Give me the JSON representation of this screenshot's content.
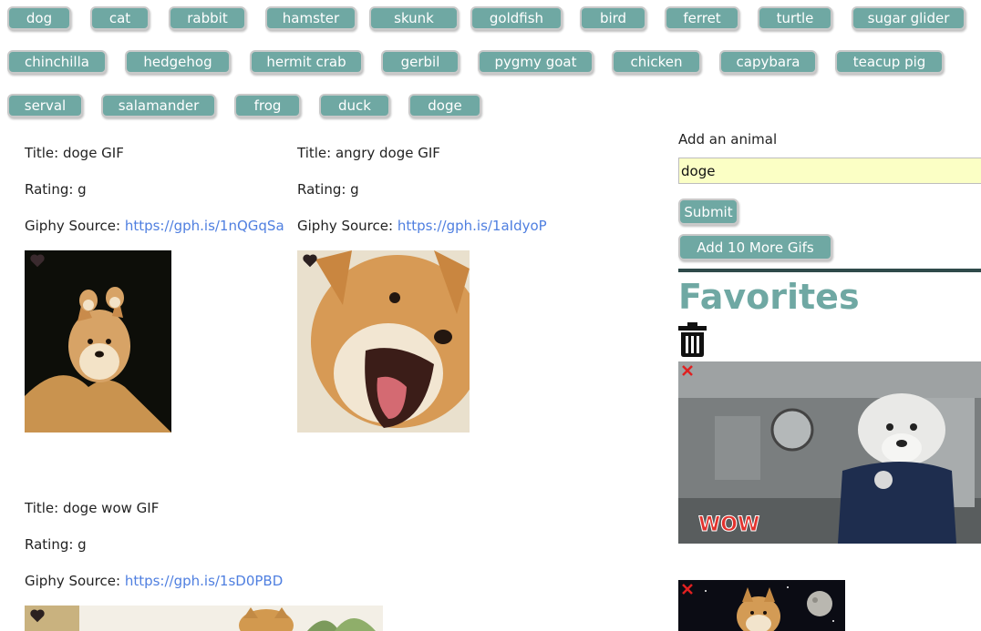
{
  "topics": [
    "dog",
    "cat",
    "rabbit",
    "hamster",
    "skunk",
    "goldfish",
    "bird",
    "ferret",
    "turtle",
    "sugar glider",
    "chinchilla",
    "hedgehog",
    "hermit crab",
    "gerbil",
    "pygmy goat",
    "chicken",
    "capybara",
    "teacup pig",
    "serval",
    "salamander",
    "frog",
    "duck",
    "doge"
  ],
  "gifs": [
    {
      "title": "Title: doge GIF",
      "rating": "Rating: g",
      "source_label": "Giphy Source: ",
      "source_url": "https://gph.is/1nQGqSa"
    },
    {
      "title": "Title: angry doge GIF",
      "rating": "Rating: g",
      "source_label": "Giphy Source: ",
      "source_url": "https://gph.is/1aIdyoP"
    },
    {
      "title": "Title: doge wow GIF",
      "rating": "Rating: g",
      "source_label": "Giphy Source: ",
      "source_url": "https://gph.is/1sD0PBD"
    }
  ],
  "form": {
    "label": "Add an animal",
    "value": "doge",
    "submit": "Submit",
    "more": "Add 10 More Gifs"
  },
  "favorites": {
    "title": "Favorites",
    "wow_text": "WOW"
  },
  "colors": {
    "button": "#6fa8a3",
    "link": "#4f7fe0",
    "input_bg": "#fbffc5",
    "divider": "#2f4a4a"
  },
  "icons": {
    "heart": "heart-icon",
    "trash": "trash-icon",
    "remove": "close-icon"
  }
}
